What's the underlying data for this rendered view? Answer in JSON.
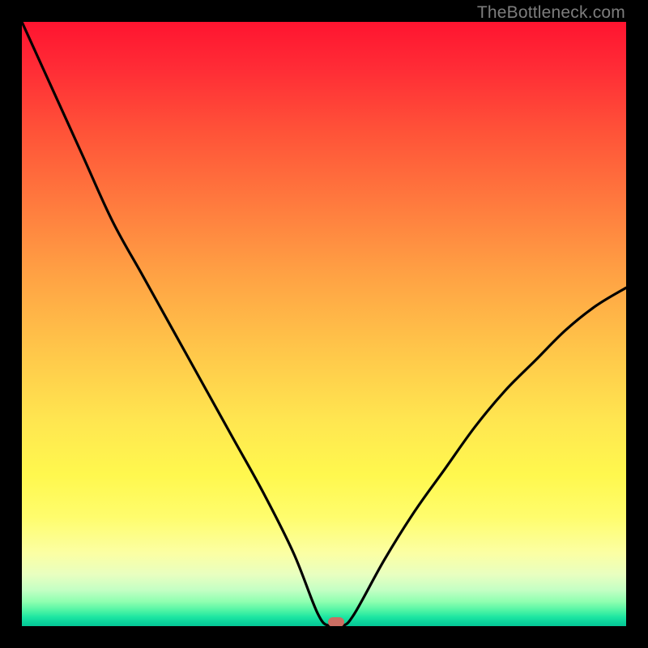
{
  "watermark": "TheBottleneck.com",
  "colors": {
    "frame": "#000000",
    "curve": "#000000",
    "marker": "#cb6d62"
  },
  "chart_data": {
    "type": "line",
    "title": "",
    "xlabel": "",
    "ylabel": "",
    "xlim": [
      0,
      1
    ],
    "ylim": [
      0,
      100
    ],
    "series": [
      {
        "name": "bottleneck_curve",
        "x": [
          0.0,
          0.05,
          0.1,
          0.15,
          0.2,
          0.25,
          0.3,
          0.35,
          0.4,
          0.45,
          0.49,
          0.51,
          0.53,
          0.55,
          0.6,
          0.65,
          0.7,
          0.75,
          0.8,
          0.85,
          0.9,
          0.95,
          1.0
        ],
        "values": [
          100,
          89,
          78,
          67,
          58,
          49,
          40,
          31,
          22,
          12,
          2,
          0,
          0,
          2,
          11,
          19,
          26,
          33,
          39,
          44,
          49,
          53,
          56
        ]
      }
    ],
    "marker": {
      "x": 0.52,
      "y": 0
    },
    "annotations": []
  }
}
